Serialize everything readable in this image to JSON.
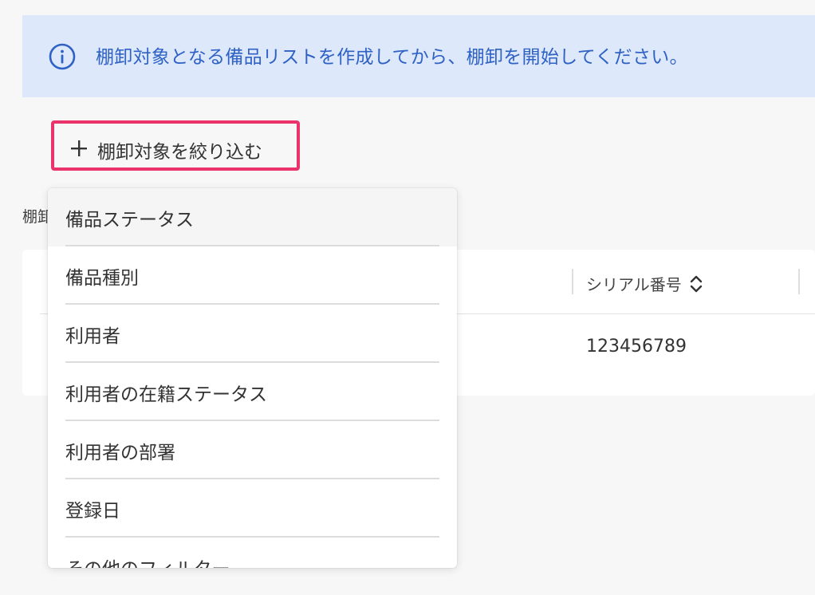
{
  "banner": {
    "icon": "info-icon",
    "text": "棚卸対象となる備品リストを作成してから、棚卸を開始してください。",
    "accent_color": "#2f62c4",
    "background_color": "#dde8fb"
  },
  "filter_button": {
    "icon": "plus-icon",
    "label": "棚卸対象を絞り込む",
    "highlight_color": "#e9336a"
  },
  "section_label": "棚卸",
  "table": {
    "columns": [
      {
        "label": "シリアル番号",
        "sort_icon": "sort-updown-icon"
      }
    ],
    "rows": [
      {
        "serial": "123456789"
      }
    ]
  },
  "dropdown": {
    "items": [
      {
        "label": "備品ステータス"
      },
      {
        "label": "備品種別"
      },
      {
        "label": "利用者"
      },
      {
        "label": "利用者の在籍ステータス"
      },
      {
        "label": "利用者の部署"
      },
      {
        "label": "登録日"
      },
      {
        "label": "その他のフィルター"
      }
    ]
  }
}
